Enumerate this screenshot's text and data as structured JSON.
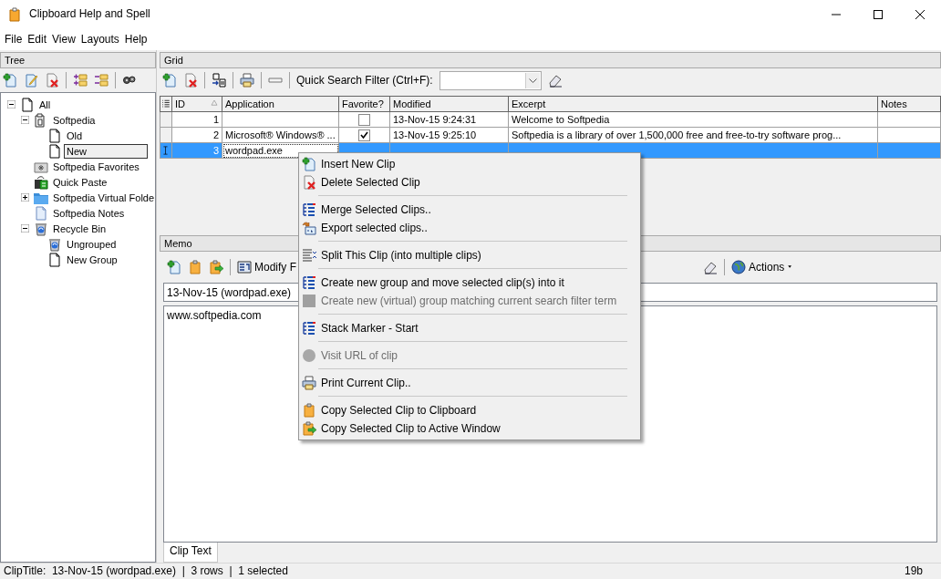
{
  "window": {
    "title": "Clipboard Help and Spell"
  },
  "menubar": [
    "File",
    "Edit",
    "View",
    "Layouts",
    "Help"
  ],
  "tree": {
    "title": "Tree",
    "nodes": [
      {
        "label": "All",
        "kind": "page",
        "expanded": true,
        "selected": false,
        "children": [
          {
            "label": "Softpedia",
            "kind": "clipboard",
            "expanded": true,
            "selected": false,
            "children": [
              {
                "label": "Old",
                "kind": "page",
                "selected": false
              },
              {
                "label": "New",
                "kind": "page",
                "selected": true
              }
            ]
          },
          {
            "label": "Softpedia Favorites",
            "kind": "favorites",
            "selected": false
          },
          {
            "label": "Quick Paste",
            "kind": "quickpaste",
            "selected": false
          },
          {
            "label": "Softpedia Virtual Folde",
            "kind": "folder",
            "expanded": false,
            "selected": false
          },
          {
            "label": "Softpedia Notes",
            "kind": "notes",
            "selected": false
          },
          {
            "label": "Recycle Bin",
            "kind": "recycle",
            "expanded": true,
            "selected": false,
            "children": [
              {
                "label": "Ungrouped",
                "kind": "recycle",
                "selected": false
              },
              {
                "label": "New Group",
                "kind": "page",
                "selected": false
              }
            ]
          }
        ]
      }
    ]
  },
  "grid": {
    "title": "Grid",
    "search_label": "Quick Search Filter (Ctrl+F):",
    "columns": [
      "ID",
      "Application",
      "Favorite?",
      "Modified",
      "Excerpt",
      "Notes"
    ],
    "rows": [
      {
        "id": "1",
        "application": "",
        "favorite": false,
        "modified": "13-Nov-15 9:24:31",
        "excerpt": "Welcome to Softpedia",
        "selected": false
      },
      {
        "id": "2",
        "application": "Microsoft® Windows® ...",
        "favorite": true,
        "modified": "13-Nov-15 9:25:10",
        "excerpt": "Softpedia is a library of over 1,500,000 free and free-to-try software prog...",
        "selected": false
      },
      {
        "id": "3",
        "application": "wordpad.exe",
        "selected": true
      }
    ]
  },
  "memo": {
    "title": "Memo",
    "modify_label": "Modify F",
    "actions_label": "Actions",
    "clip_title": "13-Nov-15 (wordpad.exe)",
    "text": "www.softpedia.com",
    "tabs": [
      {
        "label": "Clip Text",
        "selected": true
      }
    ]
  },
  "context_menu": [
    {
      "kind": "item",
      "label": "Insert New Clip",
      "disabled": false
    },
    {
      "kind": "item",
      "label": "Delete Selected Clip",
      "disabled": false
    },
    {
      "kind": "separator"
    },
    {
      "kind": "item",
      "label": "Merge Selected Clips..",
      "disabled": false
    },
    {
      "kind": "item",
      "label": "Export selected clips..",
      "disabled": false
    },
    {
      "kind": "separator"
    },
    {
      "kind": "item",
      "label": "Split This Clip (into multiple clips)",
      "disabled": false
    },
    {
      "kind": "separator"
    },
    {
      "kind": "item",
      "label": "Create new group and move selected clip(s) into it",
      "disabled": false
    },
    {
      "kind": "item",
      "label": "Create new (virtual) group matching current search filter term",
      "disabled": true
    },
    {
      "kind": "separator"
    },
    {
      "kind": "item",
      "label": "Stack Marker - Start",
      "disabled": false
    },
    {
      "kind": "separator"
    },
    {
      "kind": "item",
      "label": "Visit URL of clip",
      "disabled": true
    },
    {
      "kind": "separator"
    },
    {
      "kind": "item",
      "label": "Print Current Clip..",
      "disabled": false
    },
    {
      "kind": "separator"
    },
    {
      "kind": "item",
      "label": "Copy Selected Clip to Clipboard",
      "disabled": false
    },
    {
      "kind": "item",
      "label": "Copy Selected Clip to Active Window",
      "disabled": false
    }
  ],
  "status_bar": {
    "text": "ClipTitle:  13-Nov-15 (wordpad.exe)  |  3 rows  |  1 selected",
    "size": "19b"
  }
}
